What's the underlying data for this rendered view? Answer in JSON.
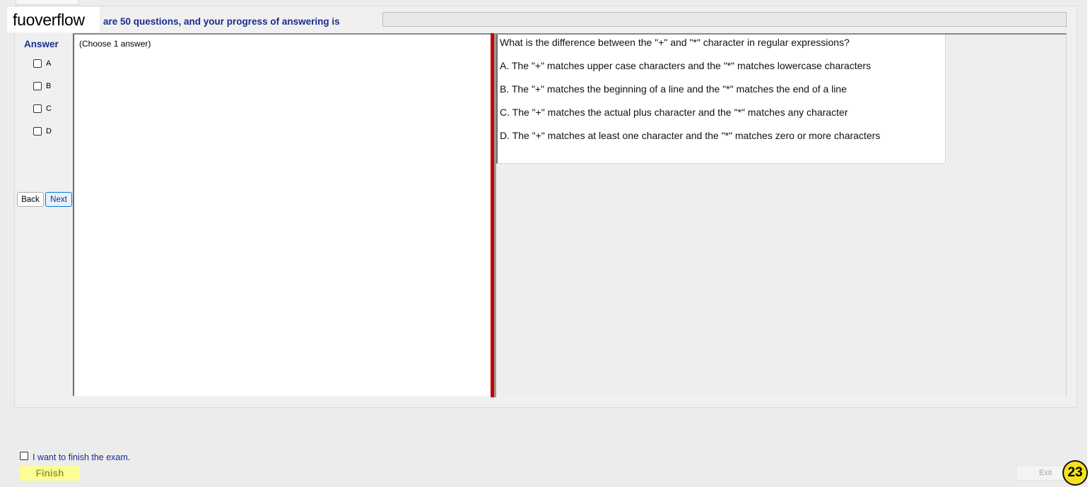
{
  "watermark": {
    "text": "fuoverflow"
  },
  "header": {
    "progress_text": "are 50 questions, and your progress of answering is",
    "progress_fraction": 0
  },
  "answer_panel": {
    "title": "Answer",
    "options": [
      "A",
      "B",
      "C",
      "D"
    ]
  },
  "nav": {
    "back_label": "Back",
    "next_label": "Next"
  },
  "left_pane": {
    "instruction": "(Choose 1 answer)"
  },
  "question": {
    "text": "What is the difference between the \"+\" and \"*\" character in regular expressions?",
    "choices": [
      "A.  The \"+\" matches upper case characters and the \"*\" matches lowercase characters",
      "B.  The \"+\" matches the beginning of a line and the \"*\" matches the end of a line",
      "C.  The \"+\" matches the actual plus character and the \"*\" matches any character",
      "D.  The \"+\" matches at least one character and the \"*\" matches zero or more characters"
    ]
  },
  "footer": {
    "finish_checkbox_label": "I want to finish the exam.",
    "finish_label": "Finish",
    "exit_label": "Exit",
    "question_number": "23"
  }
}
